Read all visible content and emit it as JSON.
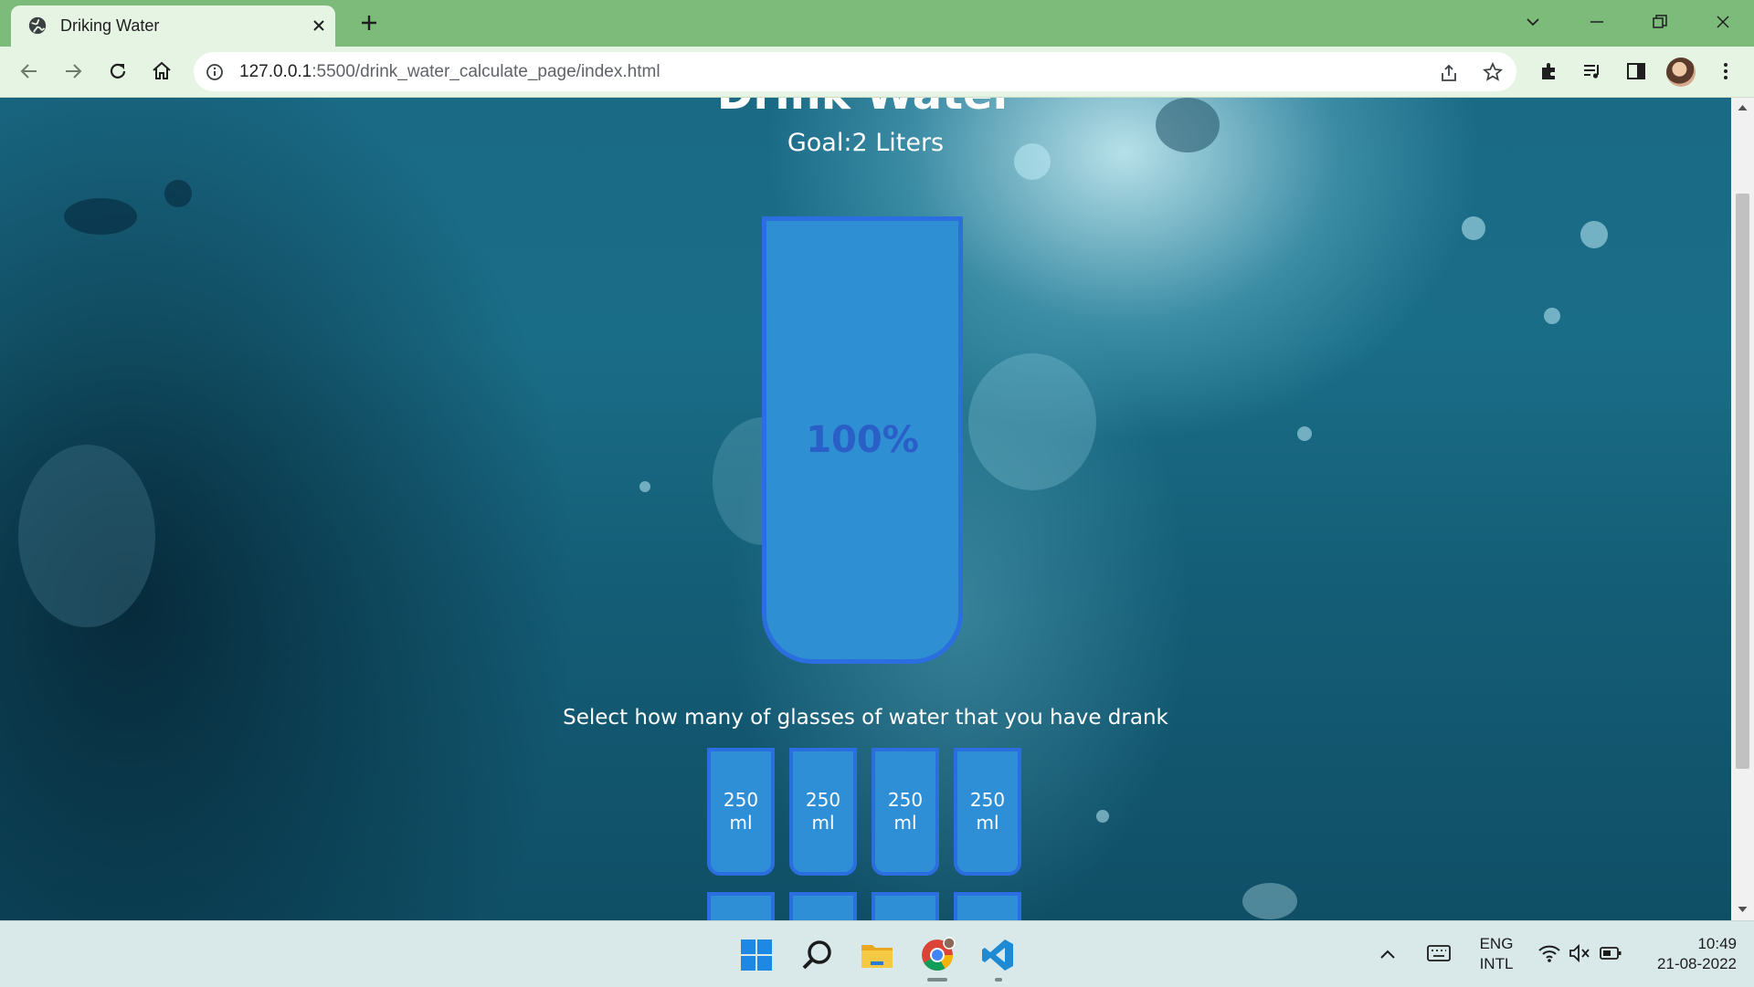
{
  "browser": {
    "tab_title": "Driking Water",
    "url_host": "127.0.0.1",
    "url_rest": ":5500/drink_water_calculate_page/index.html"
  },
  "page": {
    "title": "Drink Water",
    "goal": "Goal:2 Liters",
    "progress_percent_label": "100%",
    "progress_fraction": 1.0,
    "instruction": "Select how many of glasses of water that you have drank",
    "glasses": [
      {
        "amount": "250",
        "unit": "ml"
      },
      {
        "amount": "250",
        "unit": "ml"
      },
      {
        "amount": "250",
        "unit": "ml"
      },
      {
        "amount": "250",
        "unit": "ml"
      },
      {
        "amount": "",
        "unit": ""
      },
      {
        "amount": "",
        "unit": ""
      },
      {
        "amount": "",
        "unit": ""
      },
      {
        "amount": "",
        "unit": ""
      }
    ]
  },
  "taskbar": {
    "lang_primary": "ENG",
    "lang_secondary": "INTL",
    "time": "10:49",
    "date": "21-08-2022",
    "apps": [
      "windows-start-icon",
      "search-icon",
      "file-explorer-icon",
      "chrome-icon",
      "vscode-icon"
    ]
  },
  "colors": {
    "tab_strip": "#7dbb7a",
    "toolbar": "#e6f4e3",
    "cup_fill": "#2f8fd3",
    "cup_border": "#2b6ee0",
    "percent_text": "#2a5fc7"
  }
}
